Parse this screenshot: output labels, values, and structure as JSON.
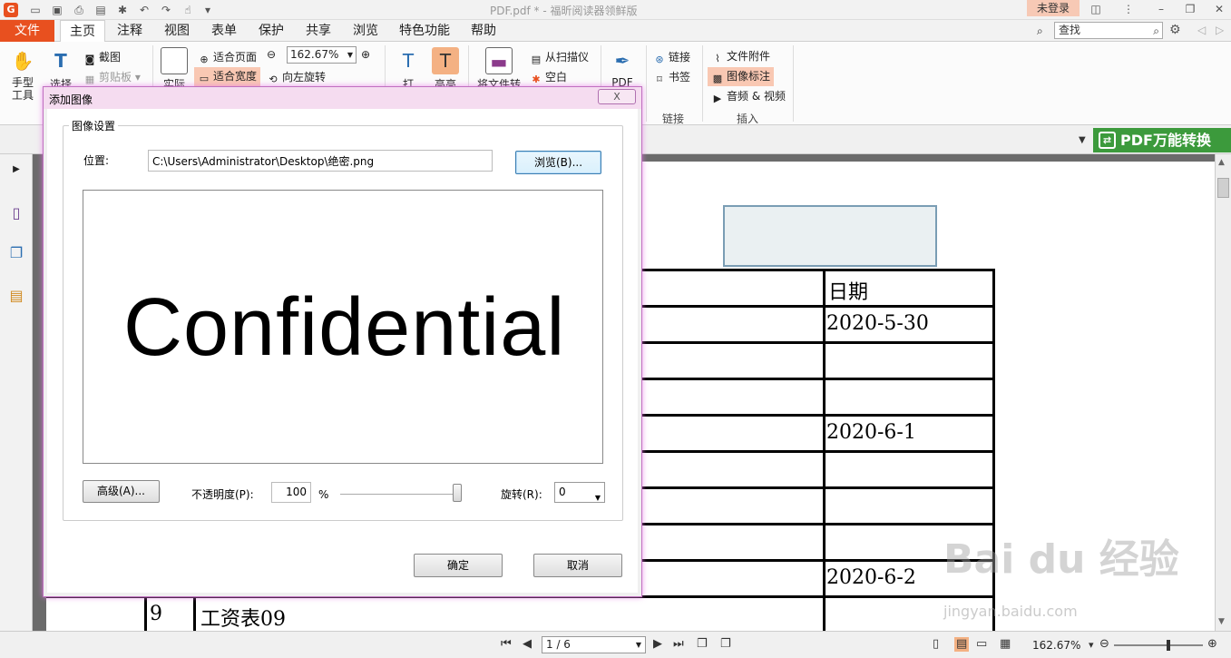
{
  "titlebar": {
    "title": "PDF.pdf * - 福昕阅读器领鲜版",
    "login": "未登录",
    "app_logo": "G"
  },
  "menubar": {
    "file": "文件",
    "tabs": [
      "主页",
      "注释",
      "视图",
      "表单",
      "保护",
      "共享",
      "浏览",
      "特色功能",
      "帮助"
    ],
    "search_placeholder": "查找"
  },
  "ribbon": {
    "hand_tool": "手型\n工具",
    "select": "选择",
    "screenshot": "截图",
    "clipboard": "剪贴板",
    "actual_size": "实际",
    "fit_page": "适合页面",
    "fit_width": "适合宽度",
    "rotate_left": "向左旋转",
    "zoom_value": "162.67%",
    "typewriter": "打",
    "highlight": "高亮",
    "convert_file": "将文件转",
    "from_scanner": "从扫描仪",
    "blank": "空白",
    "pdf_sign": "PDF",
    "link": "链接",
    "bookmark": "书签",
    "link_group": "链接",
    "file_attachment": "文件附件",
    "image_annotation": "图像标注",
    "audio_video": "音频 & 视频",
    "insert_group": "插入"
  },
  "docstrip": {
    "promo": "PDF万能转换"
  },
  "document": {
    "header_date": "日期",
    "rows": [
      {
        "date": "2020-5-30"
      },
      {
        "date": ""
      },
      {
        "date": ""
      },
      {
        "date": "2020-6-1"
      },
      {
        "date": ""
      },
      {
        "date": ""
      },
      {
        "date": ""
      },
      {
        "date": "2020-6-2"
      }
    ],
    "last_row_num": "9",
    "last_row_name": "工资表09"
  },
  "statusbar": {
    "page": "1 / 6",
    "zoom": "162.67%",
    "zoom_fraction": 0.62
  },
  "watermark": {
    "main": "Bai du 经验",
    "sub": "jingyan.baidu.com"
  },
  "dialog": {
    "title": "添加图像",
    "close": "X",
    "group_title": "图像设置",
    "location_label": "位置:",
    "location_value": "C:\\Users\\Administrator\\Desktop\\绝密.png",
    "browse_btn": "浏览(B)...",
    "preview_text": "Confidential",
    "advanced_btn": "高级(A)...",
    "opacity_label": "不透明度(P):",
    "opacity_value": "100",
    "opacity_unit": "%",
    "opacity_fraction": 1.0,
    "rotate_label": "旋转(R):",
    "rotate_value": "0",
    "ok_btn": "确定",
    "cancel_btn": "取消"
  },
  "colors": {
    "accent": "#e8501f",
    "highlight": "#f9c8b3",
    "promo": "#3c9a3c",
    "dialog_border": "#c070c0"
  }
}
